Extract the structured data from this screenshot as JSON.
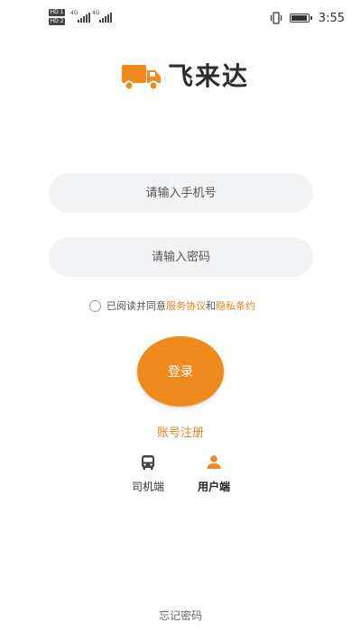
{
  "status_bar": {
    "left_tags": [
      "HD 1",
      "HD 2"
    ],
    "network_1": "4G",
    "network_2": "4G",
    "time": "3:55",
    "icons": [
      "vibrate-icon",
      "battery-icon"
    ]
  },
  "brand": {
    "name": "飞来达",
    "logo_icon": "truck-icon",
    "accent_color": "#f08a1e"
  },
  "form": {
    "phone_placeholder": "请输入手机号",
    "password_placeholder": "请输入密码",
    "agreement_prefix": "已阅读并同意",
    "service_link": "服务协议",
    "agreement_and": "和",
    "privacy_link": "隐私条约",
    "login_label": "登录"
  },
  "links": {
    "register": "账号注册",
    "forgot": "忘记密码"
  },
  "roles": [
    {
      "label": "司机端",
      "icon": "bus-icon",
      "selected": false
    },
    {
      "label": "用户端",
      "icon": "user-icon",
      "selected": true
    }
  ]
}
